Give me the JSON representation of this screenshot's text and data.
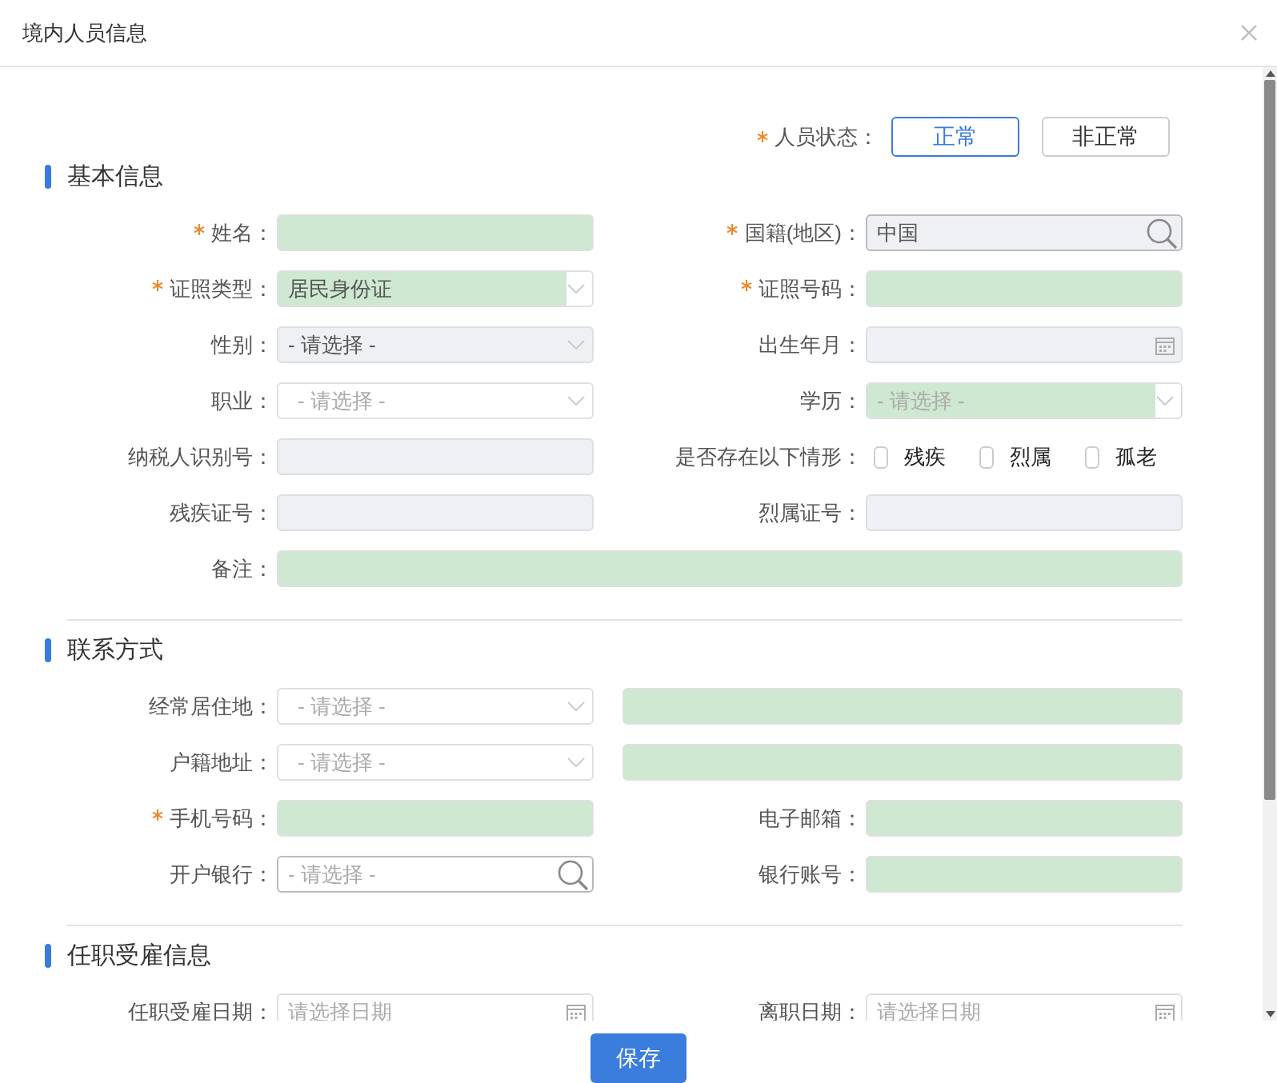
{
  "window": {
    "title": "境内人员信息"
  },
  "status": {
    "label": "人员状态：",
    "required": true,
    "options": [
      {
        "label": "正常",
        "selected": true
      },
      {
        "label": "非正常",
        "selected": false
      }
    ]
  },
  "sections": [
    {
      "title": "基本信息",
      "rows": [
        {
          "kind": "pair",
          "cells": [
            {
              "label": "姓名：",
              "required": true,
              "kind": "text",
              "highlighted": true,
              "disabled": false
            },
            {
              "label": "国籍(地区)：",
              "required": true,
              "kind": "search",
              "value": "中国",
              "highlighted": false,
              "disabled": true
            }
          ]
        },
        {
          "kind": "pair",
          "cells": [
            {
              "label": "证照类型：",
              "required": true,
              "kind": "select",
              "value": "居民身份证",
              "highlighted": true,
              "disabled": false
            },
            {
              "label": "证照号码：",
              "required": true,
              "kind": "text",
              "highlighted": true,
              "disabled": false
            }
          ]
        },
        {
          "kind": "pair",
          "cells": [
            {
              "label": "性别：",
              "required": false,
              "kind": "select",
              "value": "- 请选择 -",
              "highlighted": false,
              "disabled": true
            },
            {
              "label": "出生年月：",
              "required": false,
              "kind": "date",
              "highlighted": false,
              "disabled": true
            }
          ]
        },
        {
          "kind": "pair",
          "cells": [
            {
              "label": "职业：",
              "required": false,
              "kind": "select",
              "placeholder": "- 请选择 -",
              "highlighted": false,
              "disabled": false
            },
            {
              "label": "学历：",
              "required": false,
              "kind": "select",
              "placeholder": "- 请选择 -",
              "highlighted": true,
              "disabled": false
            }
          ]
        },
        {
          "kind": "pair",
          "cells": [
            {
              "label": "纳税人识别号：",
              "required": false,
              "kind": "text",
              "highlighted": false,
              "disabled": true
            },
            {
              "label": "是否存在以下情形：",
              "required": false,
              "kind": "checks",
              "options": [
                {
                  "label": "残疾",
                  "checked": false
                },
                {
                  "label": "烈属",
                  "checked": false
                },
                {
                  "label": "孤老",
                  "checked": false
                }
              ]
            }
          ]
        },
        {
          "kind": "pair",
          "cells": [
            {
              "label": "残疾证号：",
              "required": false,
              "kind": "text",
              "highlighted": false,
              "disabled": true
            },
            {
              "label": "烈属证号：",
              "required": false,
              "kind": "text",
              "highlighted": false,
              "disabled": true
            }
          ]
        },
        {
          "kind": "full",
          "cells": [
            {
              "label": "备注：",
              "required": false,
              "kind": "text",
              "highlighted": true,
              "disabled": false
            }
          ]
        }
      ]
    },
    {
      "title": "联系方式",
      "rows": [
        {
          "kind": "address",
          "cells": [
            {
              "label": "经常居住地：",
              "required": false,
              "kind": "select",
              "placeholder": "- 请选择 -",
              "highlighted": false,
              "disabled": false
            },
            {
              "kind": "text",
              "highlighted": true,
              "disabled": false
            }
          ]
        },
        {
          "kind": "address",
          "cells": [
            {
              "label": "户籍地址：",
              "required": false,
              "kind": "select",
              "placeholder": "- 请选择 -",
              "highlighted": false,
              "disabled": false
            },
            {
              "kind": "text",
              "highlighted": true,
              "disabled": false
            }
          ]
        },
        {
          "kind": "pair",
          "cells": [
            {
              "label": "手机号码：",
              "required": true,
              "kind": "text",
              "highlighted": true,
              "disabled": false
            },
            {
              "label": "电子邮箱：",
              "required": false,
              "kind": "text",
              "highlighted": true,
              "disabled": false
            }
          ]
        },
        {
          "kind": "pair",
          "cells": [
            {
              "label": "开户银行：",
              "required": false,
              "kind": "search",
              "placeholder": "- 请选择 -",
              "highlighted": false,
              "disabled": false
            },
            {
              "label": "银行账号：",
              "required": false,
              "kind": "text",
              "highlighted": true,
              "disabled": false
            }
          ]
        }
      ]
    },
    {
      "title": "任职受雇信息",
      "rows": [
        {
          "kind": "pair",
          "cells": [
            {
              "label": "任职受雇日期：",
              "required": false,
              "kind": "date",
              "placeholder": "请选择日期",
              "highlighted": false,
              "disabled": false
            },
            {
              "label": "离职日期：",
              "required": false,
              "kind": "date",
              "placeholder": "请选择日期",
              "highlighted": false,
              "disabled": false
            }
          ]
        }
      ]
    }
  ],
  "footer": {
    "button": "保存"
  }
}
